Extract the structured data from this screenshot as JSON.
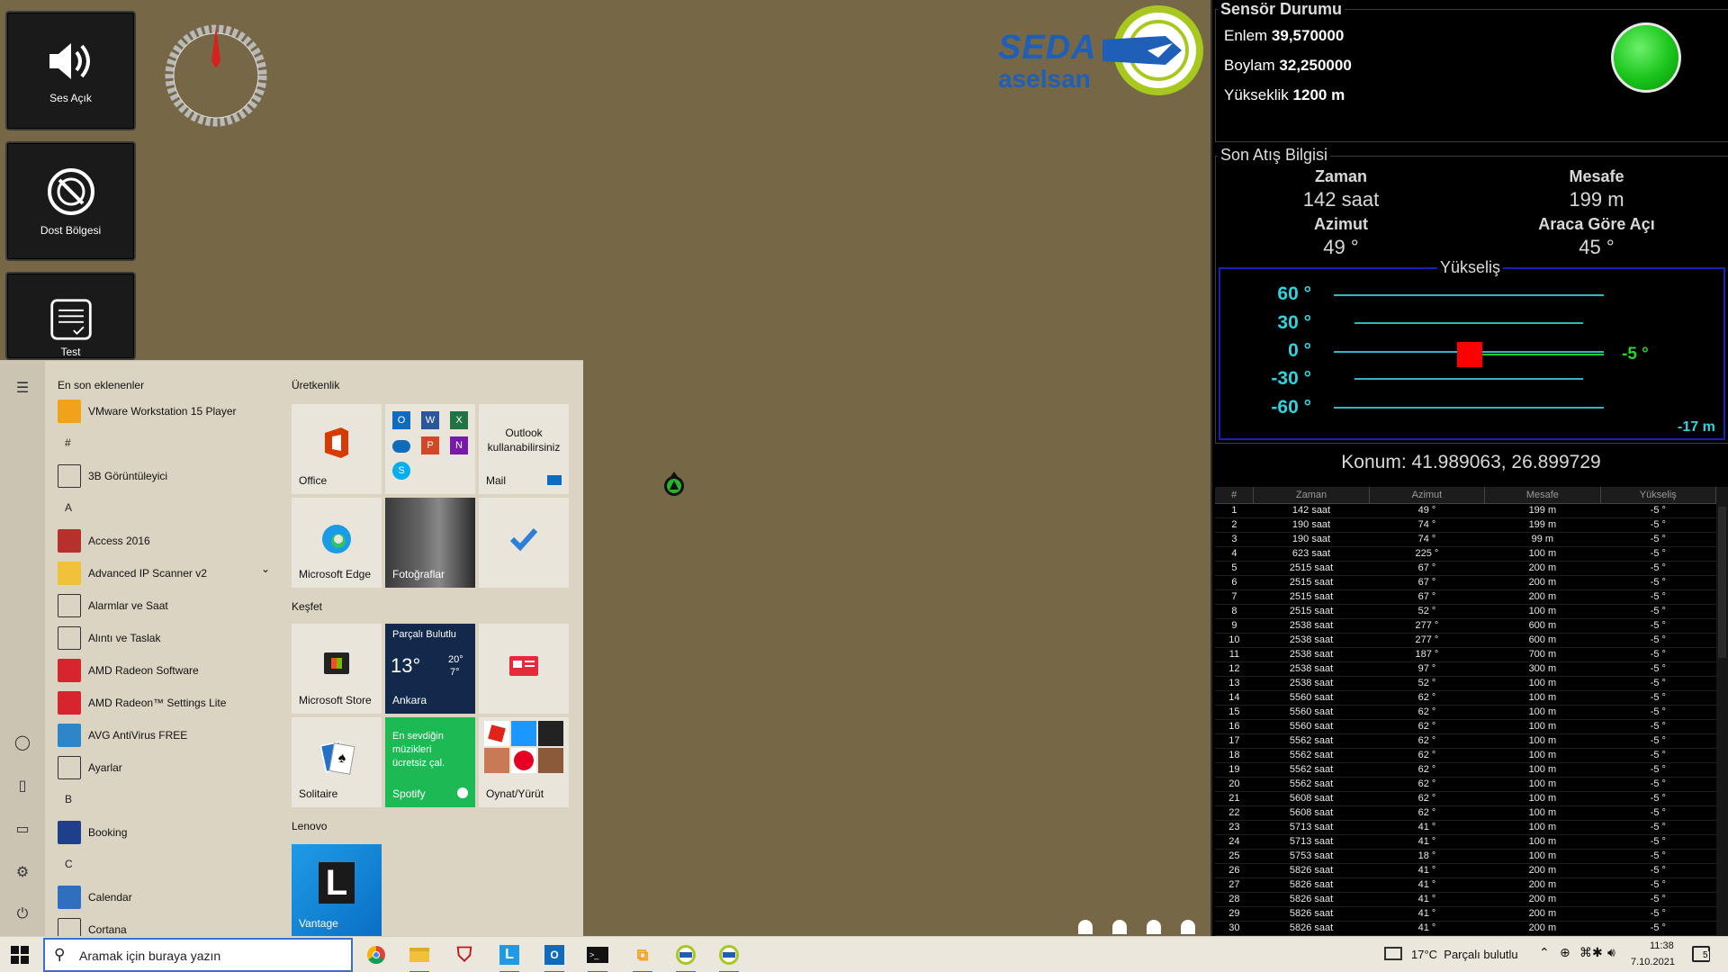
{
  "side_buttons": [
    {
      "label": "Ses Açık",
      "icon": "speaker-icon"
    },
    {
      "label": "Dost Bölgesi",
      "icon": "no-entry-icon"
    },
    {
      "label": "Test",
      "icon": "checklist-icon"
    }
  ],
  "logo": {
    "line1": "SEDA",
    "line2": "aselsan"
  },
  "sensor": {
    "title": "Sensör Durumu",
    "lat_label": "Enlem",
    "lat_value": "39,570000",
    "lon_label": "Boylam",
    "lon_value": "32,250000",
    "alt_label": "Yükseklik",
    "alt_value": "1200 m",
    "status_color": "#19c419"
  },
  "last_shot": {
    "title": "Son Atış Bilgisi",
    "time_label": "Zaman",
    "time_value": "142 saat",
    "dist_label": "Mesafe",
    "dist_value": "199 m",
    "az_label": "Azimut",
    "az_value": "49 °",
    "angle_label": "Araca Göre Açı",
    "angle_value": "45 °"
  },
  "elevation": {
    "title": "Yükseliş",
    "ticks": [
      "60 °",
      "30 °",
      "0 °",
      "-30 °",
      "-60 °"
    ],
    "marker_label": "-5 °",
    "height_label": "-17 m"
  },
  "position": "Konum: 41.989063, 26.899729",
  "table": {
    "headers": [
      "#",
      "Zaman",
      "Azimut",
      "Mesafe",
      "Yükseliş"
    ],
    "rows": [
      [
        "1",
        "142 saat",
        "49 °",
        "199 m",
        "-5 °"
      ],
      [
        "2",
        "190 saat",
        "74 °",
        "199 m",
        "-5 °"
      ],
      [
        "3",
        "190 saat",
        "74 °",
        "99 m",
        "-5 °"
      ],
      [
        "4",
        "623 saat",
        "225 °",
        "100 m",
        "-5 °"
      ],
      [
        "5",
        "2515 saat",
        "67 °",
        "200 m",
        "-5 °"
      ],
      [
        "6",
        "2515 saat",
        "67 °",
        "200 m",
        "-5 °"
      ],
      [
        "7",
        "2515 saat",
        "67 °",
        "200 m",
        "-5 °"
      ],
      [
        "8",
        "2515 saat",
        "52 °",
        "100 m",
        "-5 °"
      ],
      [
        "9",
        "2538 saat",
        "277 °",
        "600 m",
        "-5 °"
      ],
      [
        "10",
        "2538 saat",
        "277 °",
        "600 m",
        "-5 °"
      ],
      [
        "11",
        "2538 saat",
        "187 °",
        "700 m",
        "-5 °"
      ],
      [
        "12",
        "2538 saat",
        "97 °",
        "300 m",
        "-5 °"
      ],
      [
        "13",
        "2538 saat",
        "52 °",
        "100 m",
        "-5 °"
      ],
      [
        "14",
        "5560 saat",
        "62 °",
        "100 m",
        "-5 °"
      ],
      [
        "15",
        "5560 saat",
        "62 °",
        "100 m",
        "-5 °"
      ],
      [
        "16",
        "5560 saat",
        "62 °",
        "100 m",
        "-5 °"
      ],
      [
        "17",
        "5562 saat",
        "62 °",
        "100 m",
        "-5 °"
      ],
      [
        "18",
        "5562 saat",
        "62 °",
        "100 m",
        "-5 °"
      ],
      [
        "19",
        "5562 saat",
        "62 °",
        "100 m",
        "-5 °"
      ],
      [
        "20",
        "5562 saat",
        "62 °",
        "100 m",
        "-5 °"
      ],
      [
        "21",
        "5608 saat",
        "62 °",
        "100 m",
        "-5 °"
      ],
      [
        "22",
        "5608 saat",
        "62 °",
        "100 m",
        "-5 °"
      ],
      [
        "23",
        "5713 saat",
        "41 °",
        "100 m",
        "-5 °"
      ],
      [
        "24",
        "5713 saat",
        "41 °",
        "100 m",
        "-5 °"
      ],
      [
        "25",
        "5753 saat",
        "18 °",
        "100 m",
        "-5 °"
      ],
      [
        "26",
        "5826 saat",
        "41 °",
        "200 m",
        "-5 °"
      ],
      [
        "27",
        "5826 saat",
        "41 °",
        "200 m",
        "-5 °"
      ],
      [
        "28",
        "5826 saat",
        "41 °",
        "200 m",
        "-5 °"
      ],
      [
        "29",
        "5826 saat",
        "41 °",
        "200 m",
        "-5 °"
      ],
      [
        "30",
        "5826 saat",
        "41 °",
        "200 m",
        "-5 °"
      ]
    ]
  },
  "start_menu": {
    "recent_title": "En son eklenenler",
    "items": [
      {
        "type": "app",
        "label": "VMware Workstation 15 Player",
        "icon": "vmware-icon",
        "color": "#f0a21a"
      },
      {
        "type": "letter",
        "label": "#"
      },
      {
        "type": "app",
        "label": "3B Görüntüleyici",
        "icon": "cube-icon",
        "color": "#ffffff"
      },
      {
        "type": "letter",
        "label": "A"
      },
      {
        "type": "app",
        "label": "Access 2016",
        "icon": "access-icon",
        "color": "#b7302c"
      },
      {
        "type": "app",
        "label": "Advanced IP Scanner v2",
        "icon": "folder-icon",
        "color": "#f2c13a",
        "chevron": true
      },
      {
        "type": "app",
        "label": "Alarmlar ve Saat",
        "icon": "clock-icon",
        "color": "#ffffff"
      },
      {
        "type": "app",
        "label": "Alıntı ve Taslak",
        "icon": "snip-icon",
        "color": "#ffffff"
      },
      {
        "type": "app",
        "label": "AMD Radeon Software",
        "icon": "amd-icon",
        "color": "#d6252e"
      },
      {
        "type": "app",
        "label": "AMD Radeon™ Settings Lite",
        "icon": "amd-lite-icon",
        "color": "#d6252e"
      },
      {
        "type": "app",
        "label": "AVG AntiVirus FREE",
        "icon": "avg-icon",
        "color": "#2e86c8"
      },
      {
        "type": "app",
        "label": "Ayarlar",
        "icon": "gear-icon",
        "color": "#ffffff"
      },
      {
        "type": "letter",
        "label": "B"
      },
      {
        "type": "app",
        "label": "Booking",
        "icon": "booking-icon",
        "color": "#1f3f8d"
      },
      {
        "type": "letter",
        "label": "C"
      },
      {
        "type": "app",
        "label": "Calendar",
        "icon": "calendar-icon",
        "color": "#2f6fbf"
      },
      {
        "type": "app",
        "label": "Cortana",
        "icon": "cortana-icon",
        "color": "#ffffff"
      }
    ],
    "groups": {
      "prod": "Üretkenlik",
      "explore": "Keşfet",
      "lenovo": "Lenovo"
    },
    "tiles": {
      "office": "Office",
      "outlook_msg": "Outlook kullanabilirsiniz",
      "mail": "Mail",
      "edge": "Microsoft Edge",
      "photos": "Fotoğraflar",
      "store": "Microsoft Store",
      "weather_title": "Parçalı Bulutlu",
      "weather_temp": "13°",
      "weather_hi": "20°",
      "weather_lo": "7°",
      "weather_city": "Ankara",
      "solitaire": "Solitaire",
      "spotify_msg": "En sevdiğin müzikleri ücretsiz çal.",
      "spotify": "Spotify",
      "play": "Oynat/Yürüt",
      "vantage": "Vantage"
    }
  },
  "taskbar": {
    "search_placeholder": "Aramak için buraya yazın",
    "weather": "17°C  Parçalı bulutlu",
    "time": "11:38",
    "date": "7.10.2021",
    "notif_count": "5"
  }
}
